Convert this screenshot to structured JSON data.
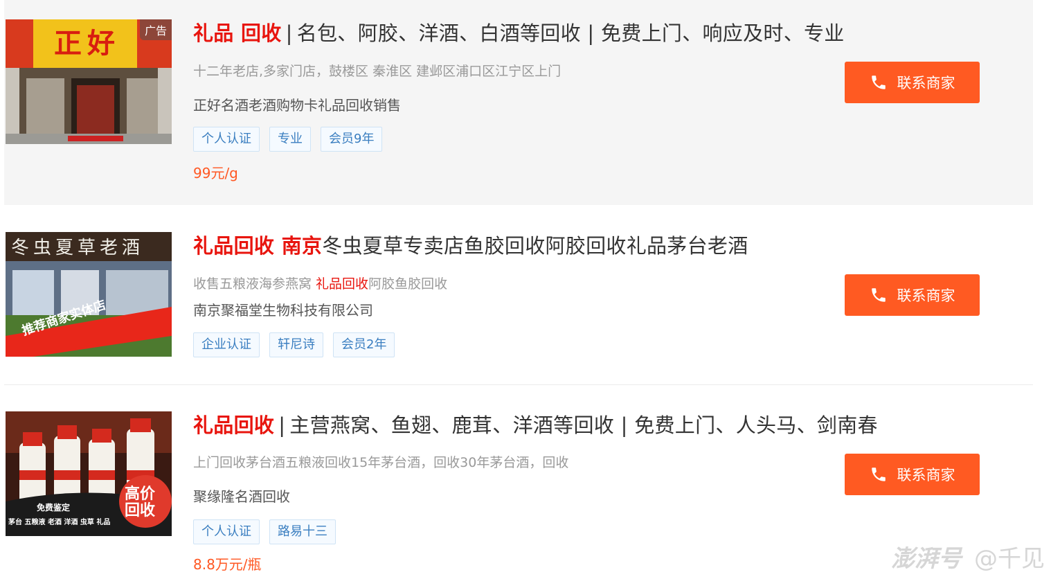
{
  "listings": [
    {
      "title_kw": "礼品 回收",
      "title_sep": "|",
      "title_rest": "名包、阿胶、洋酒、白酒等回收 | 免费上门、响应及时、专业",
      "desc": "十二年老店,多家门店，鼓楼区 秦淮区 建邺区浦口区江宁区上门",
      "company": "正好名酒老酒购物卡礼品回收销售",
      "tags": [
        "个人认证",
        "专业",
        "会员9年"
      ],
      "price": "99元/g",
      "contact_label": "联系商家",
      "ad_badge": "广告",
      "thumb_text": "正好"
    },
    {
      "title_kw": "礼品回收 南京",
      "title_rest": "冬虫夏草专卖店鱼胶回收阿胶回收礼品茅台老酒",
      "desc_pre": "收售五粮液海参燕窝 ",
      "desc_hl": "礼品回收",
      "desc_post": "阿胶鱼胶回收",
      "company": "南京聚福堂生物科技有限公司",
      "tags": [
        "企业认证",
        "轩尼诗",
        "会员2年"
      ],
      "contact_label": "联系商家",
      "thumb_sign": "冬虫夏草老酒",
      "thumb_banner": "推荐商家实体店"
    },
    {
      "title_kw": "礼品回收",
      "title_sep": "|",
      "title_rest": "主营燕窝、鱼翅、鹿茸、洋酒等回收 | 免费上门、人头马、剑南春",
      "desc": "上门回收茅台酒五粮液回收15年茅台酒，回收30年茅台酒，回收",
      "company": "聚缘隆名酒回收",
      "tags": [
        "个人认证",
        "路易十三"
      ],
      "price": "8.8万元/瓶",
      "contact_label": "联系商家",
      "thumb_badge_1": "高价",
      "thumb_badge_2": "回收",
      "thumb_strip_1": "免费鉴定",
      "thumb_strip_2": "茅台 五粮液 老酒 洋酒 虫草 礼品"
    }
  ],
  "watermark": {
    "brand": "澎湃号",
    "author": "@千见"
  },
  "colors": {
    "accent": "#e8150e",
    "button": "#ff5a22",
    "tag_text": "#3a7ec0"
  }
}
